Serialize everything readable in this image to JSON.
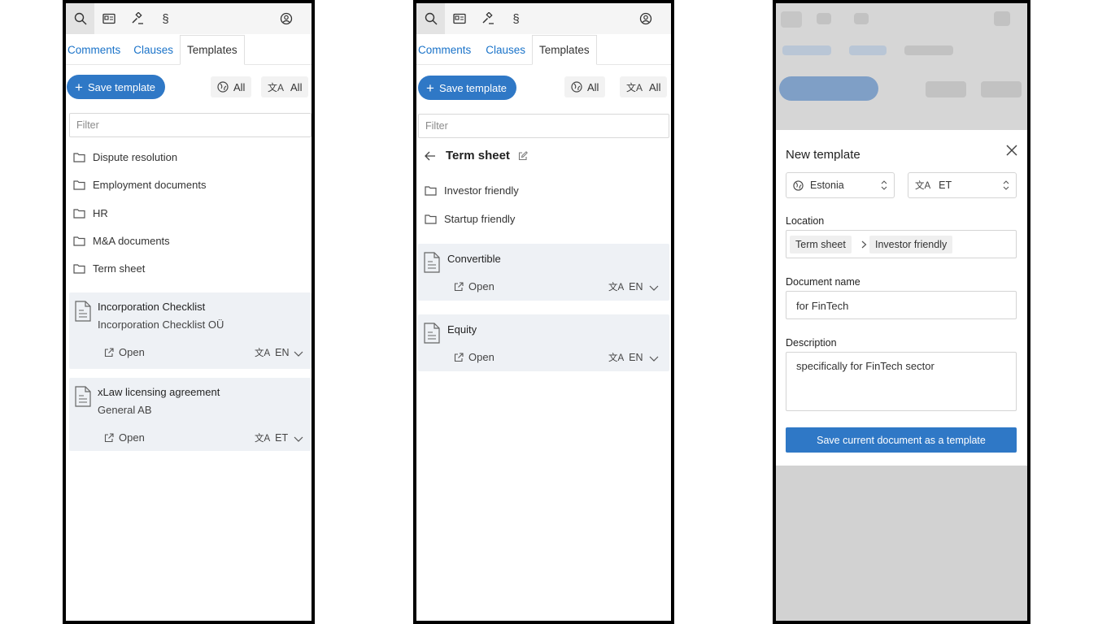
{
  "toolbar": {
    "section_glyph": "§",
    "icons": [
      "search-icon",
      "id-card-icon",
      "gavel-icon",
      "section-icon",
      "account-icon"
    ]
  },
  "tabs": [
    "Comments",
    "Clauses",
    "Templates"
  ],
  "save_template_label": "Save template",
  "filter_placeholder": "Filter",
  "region_filter": "All",
  "language_filter": "All",
  "translate_glyph": "文A",
  "open_label": "Open",
  "panel1": {
    "folders": [
      "Dispute resolution",
      "Employment documents",
      "HR",
      "M&A documents",
      "Term sheet"
    ],
    "cards": [
      {
        "title": "Incorporation Checklist",
        "subtitle": "Incorporation Checklist OÜ",
        "lang": "EN"
      },
      {
        "title": "xLaw licensing agreement",
        "subtitle": "General AB",
        "lang": "ET"
      }
    ]
  },
  "panel2": {
    "folder_title": "Term sheet",
    "folders": [
      "Investor friendly",
      "Startup friendly"
    ],
    "cards": [
      {
        "title": "Convertible",
        "lang": "EN"
      },
      {
        "title": "Equity",
        "lang": "EN"
      }
    ]
  },
  "modal": {
    "title": "New template",
    "country": "Estonia",
    "language": "ET",
    "location_label": "Location",
    "location_path": [
      "Term sheet",
      "Investor friendly"
    ],
    "name_label": "Document name",
    "name_value": "for FinTech",
    "description_label": "Description",
    "description_value": "specifically for FinTech sector",
    "submit_label": "Save current document as a template"
  },
  "colors": {
    "accent": "#2f78c6",
    "link": "#1a73c9",
    "card_bg": "#eef1f5"
  }
}
